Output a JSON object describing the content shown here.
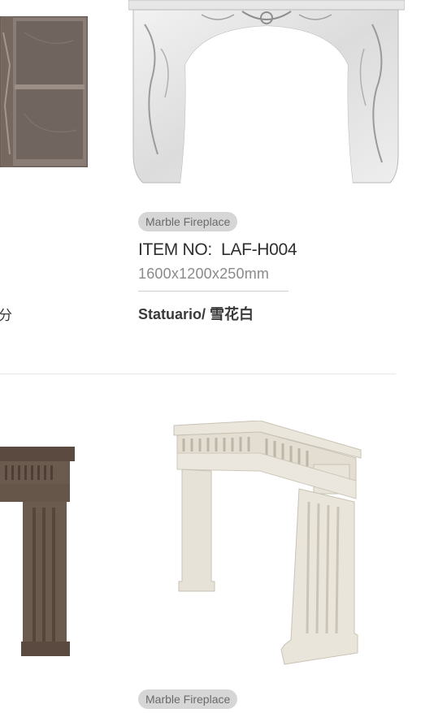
{
  "products": [
    {
      "tag": "Marble Fireplace",
      "item_no": "ITEM NO:  LAF-H004",
      "dimensions": "1600x1200x250mm",
      "material": "Statuario/ 雪花白"
    },
    {
      "tag": "Marble Fireplace"
    }
  ],
  "left_column": {
    "material_fragment": "分"
  },
  "colors": {
    "tag_bg": "#d6d6d6",
    "tag_text": "#6a6a6a",
    "divider": "#e8e8e8"
  }
}
